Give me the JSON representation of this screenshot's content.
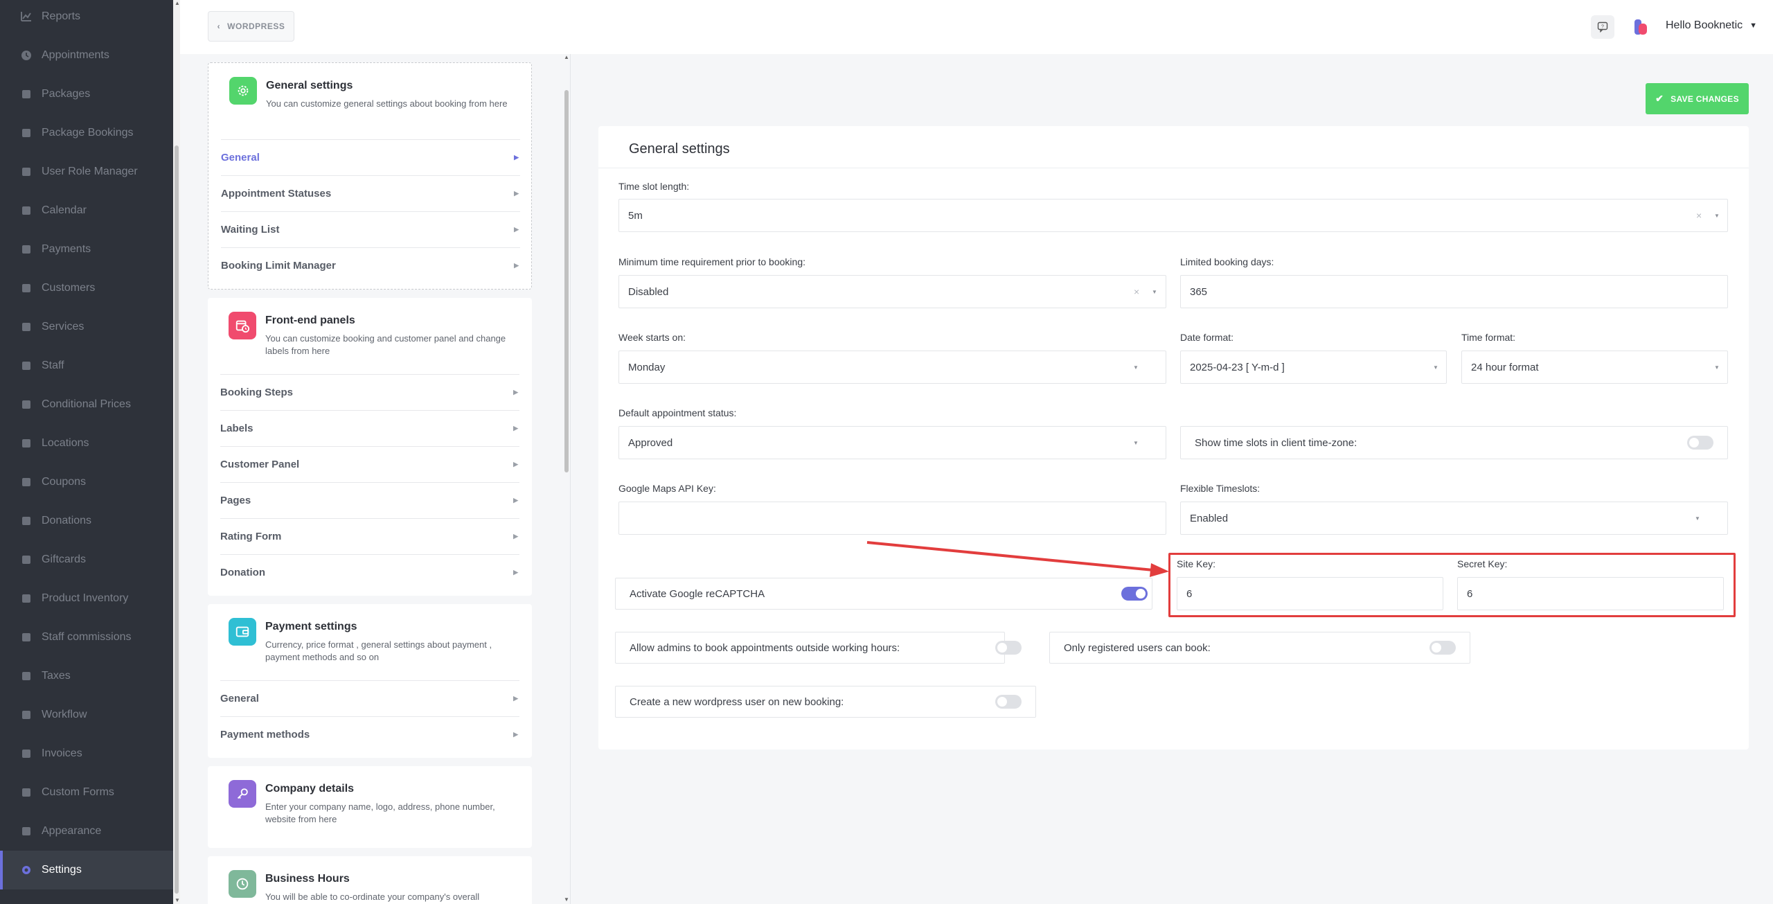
{
  "sidebar": {
    "items": [
      {
        "label": "Reports",
        "icon": "chart-line-icon"
      },
      {
        "label": "Appointments",
        "icon": "clock-icon"
      },
      {
        "label": "Packages",
        "icon": "boxes-icon"
      },
      {
        "label": "Package Bookings",
        "icon": "package-booking-icon"
      },
      {
        "label": "User Role Manager",
        "icon": "user-cog-icon"
      },
      {
        "label": "Calendar",
        "icon": "calendar-icon"
      },
      {
        "label": "Payments",
        "icon": "credit-card-icon"
      },
      {
        "label": "Customers",
        "icon": "users-icon"
      },
      {
        "label": "Services",
        "icon": "list-icon"
      },
      {
        "label": "Staff",
        "icon": "user-icon"
      },
      {
        "label": "Conditional Prices",
        "icon": "i-cursor-icon"
      },
      {
        "label": "Locations",
        "icon": "location-arrow-icon"
      },
      {
        "label": "Coupons",
        "icon": "tag-icon"
      },
      {
        "label": "Donations",
        "icon": "donation-icon"
      },
      {
        "label": "Giftcards",
        "icon": "gift-icon"
      },
      {
        "label": "Product Inventory",
        "icon": "tools-icon"
      },
      {
        "label": "Staff commissions",
        "icon": "handshake-icon"
      },
      {
        "label": "Taxes",
        "icon": "percent-icon"
      },
      {
        "label": "Workflow",
        "icon": "workflow-icon"
      },
      {
        "label": "Invoices",
        "icon": "file-icon"
      },
      {
        "label": "Custom Forms",
        "icon": "form-icon"
      },
      {
        "label": "Appearance",
        "icon": "brush-icon"
      },
      {
        "label": "Settings",
        "icon": "gear-icon",
        "active": true
      }
    ]
  },
  "topbar": {
    "back_label": "WORDPRESS",
    "user_greeting": "Hello Booknetic"
  },
  "menu": {
    "general": {
      "title": "General settings",
      "desc": "You can customize general settings about booking from here",
      "items": [
        "General",
        "Appointment Statuses",
        "Waiting List",
        "Booking Limit Manager"
      ]
    },
    "frontend": {
      "title": "Front-end panels",
      "desc": "You can customize booking and customer panel and change labels from here",
      "items": [
        "Booking Steps",
        "Labels",
        "Customer Panel",
        "Pages",
        "Rating Form",
        "Donation"
      ]
    },
    "payment": {
      "title": "Payment settings",
      "desc": "Currency, price format , general settings about payment , payment methods and so on",
      "items": [
        "General",
        "Payment methods"
      ]
    },
    "company": {
      "title": "Company details",
      "desc": "Enter your company name, logo, address, phone number, website from here"
    },
    "business": {
      "title": "Business Hours",
      "desc": "You will be able to co-ordinate your company's overall"
    }
  },
  "main": {
    "save_label": "SAVE CHANGES",
    "title": "General settings",
    "time_slot_length": {
      "label": "Time slot length:",
      "value": "5m"
    },
    "min_time": {
      "label": "Minimum time requirement prior to booking:",
      "value": "Disabled"
    },
    "limited_days": {
      "label": "Limited booking days:",
      "value": "365"
    },
    "week_start": {
      "label": "Week starts on:",
      "value": "Monday"
    },
    "date_format": {
      "label": "Date format:",
      "value": "2025-04-23 [ Y-m-d ]"
    },
    "time_format": {
      "label": "Time format:",
      "value": "24 hour format"
    },
    "default_status": {
      "label": "Default appointment status:",
      "value": "Approved"
    },
    "client_timezone": {
      "label": "Show time slots in client time-zone:",
      "on": false
    },
    "gmaps_key": {
      "label": "Google Maps API Key:",
      "value": ""
    },
    "flexible": {
      "label": "Flexible Timeslots:",
      "value": "Enabled"
    },
    "recaptcha": {
      "label": "Activate Google reCAPTCHA",
      "on": true
    },
    "site_key": {
      "label": "Site Key:",
      "value": "6"
    },
    "secret_key": {
      "label": "Secret Key:",
      "value": "6"
    },
    "allow_admins": {
      "label": "Allow admins to book appointments outside working hours:",
      "on": false
    },
    "only_registered": {
      "label": "Only registered users can book:",
      "on": false
    },
    "create_wp_user": {
      "label": "Create a new wordpress user on new booking:",
      "on": false
    }
  },
  "colors": {
    "accent": "#6c70dc",
    "save": "#53d56c",
    "highlight": "#e23d3d",
    "sidebar": "#2e323a"
  }
}
